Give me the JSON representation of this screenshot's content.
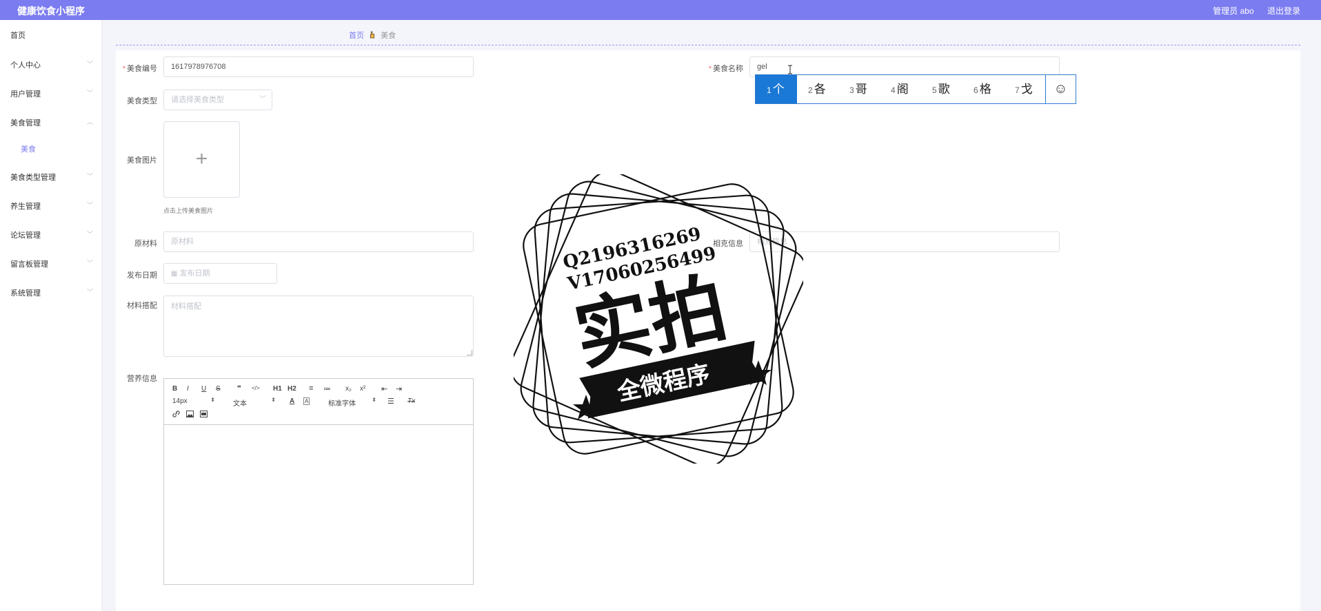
{
  "header": {
    "app_title": "健康饮食小程序",
    "user_label": "管理员 abo",
    "logout_label": "退出登录"
  },
  "sidebar": {
    "items": [
      {
        "label": "首页",
        "has_children": false
      },
      {
        "label": "个人中心",
        "has_children": true
      },
      {
        "label": "用户管理",
        "has_children": true
      },
      {
        "label": "美食管理",
        "has_children": true
      },
      {
        "label": "美食类型管理",
        "has_children": true
      },
      {
        "label": "养生管理",
        "has_children": true
      },
      {
        "label": "论坛管理",
        "has_children": true
      },
      {
        "label": "留言板管理",
        "has_children": true
      },
      {
        "label": "系统管理",
        "has_children": true
      }
    ],
    "active_sub": "美食"
  },
  "breadcrumb": {
    "home": "首页",
    "current": "美食"
  },
  "form": {
    "food_no": {
      "label": "美食编号",
      "required": true,
      "value": "1617978976708"
    },
    "food_name": {
      "label": "美食名称",
      "required": true,
      "value": "gel"
    },
    "food_type": {
      "label": "美食类型",
      "placeholder": "请选择美食类型"
    },
    "food_image": {
      "label": "美食图片",
      "tip": "点击上传美食图片"
    },
    "ingredients": {
      "label": "原材料",
      "placeholder": "原材料"
    },
    "related_info": {
      "label": "相克信息",
      "placeholder": "相克信息"
    },
    "publish_date": {
      "label": "发布日期",
      "placeholder": "发布日期"
    },
    "material_match": {
      "label": "材料搭配",
      "placeholder": "材料搭配"
    },
    "nutrition": {
      "label": "营养信息"
    }
  },
  "editor": {
    "row1": [
      "B",
      "I",
      "U",
      "S",
      "❞",
      "</>",
      "H1",
      "H2",
      "≡",
      "≔",
      "x₂",
      "x²",
      "⇤",
      "⇥"
    ],
    "font_size": "14px",
    "block_type": "文本",
    "font_family": "标准字体"
  },
  "ime": {
    "candidates": [
      {
        "num": "1",
        "char": "个"
      },
      {
        "num": "2",
        "char": "各"
      },
      {
        "num": "3",
        "char": "哥"
      },
      {
        "num": "4",
        "char": "阁"
      },
      {
        "num": "5",
        "char": "歌"
      },
      {
        "num": "6",
        "char": "格"
      },
      {
        "num": "7",
        "char": "戈"
      }
    ]
  },
  "watermark": {
    "line1": "Q2196316269",
    "line2": "V17060256499",
    "main": "实拍",
    "ribbon": "全微程序"
  },
  "colors": {
    "accent": "#7b7cf0",
    "ime_selected": "#1a78d6",
    "required": "#f56c6c"
  }
}
